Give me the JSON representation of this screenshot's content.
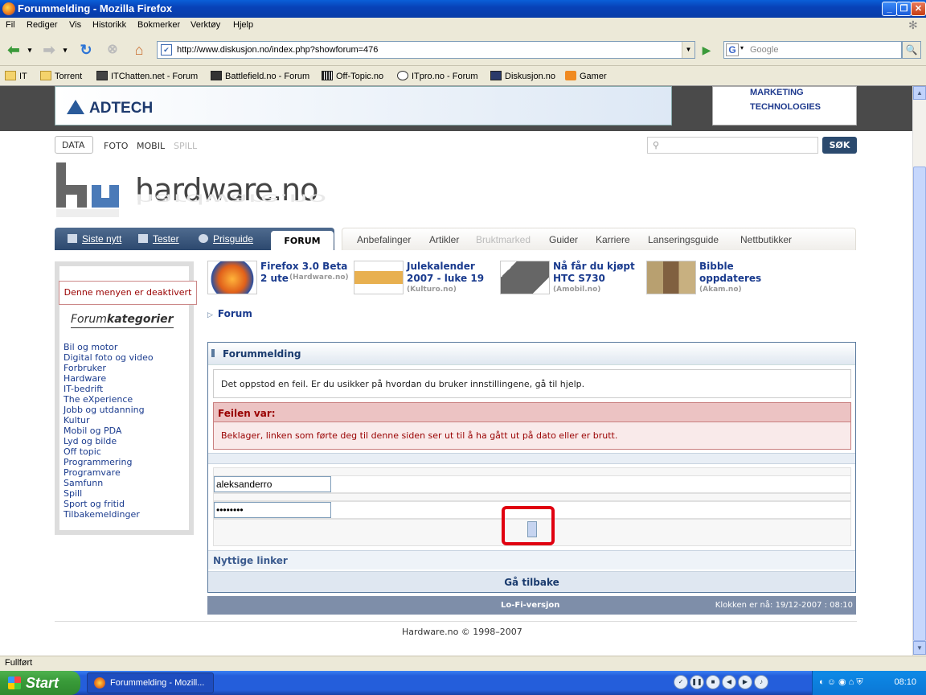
{
  "window": {
    "title": "Forummelding - Mozilla Firefox"
  },
  "menu": [
    "Fil",
    "Rediger",
    "Vis",
    "Historikk",
    "Bokmerker",
    "Verktøy",
    "Hjelp"
  ],
  "nav": {
    "url": "http://www.diskusjon.no/index.php?showforum=476",
    "search_placeholder": "Google"
  },
  "bookmarks": [
    "IT",
    "Torrent",
    "ITChatten.net - Forum",
    "Battlefield.no - Forum",
    "Off-Topic.no",
    "ITpro.no - Forum",
    "Diskusjon.no",
    "Gamer"
  ],
  "ads": {
    "left_logo": "ADTECH",
    "right_line1": "MARKETING",
    "right_line2": "TECHNOLOGIES"
  },
  "site": {
    "toplinks": [
      "DATA",
      "FOTO",
      "MOBIL",
      "SPILL"
    ],
    "search_button": "SØK",
    "brand": "hardware.no",
    "dark_tabs": [
      "Siste nytt",
      "Tester",
      "Prisguide",
      "FORUM"
    ],
    "light_tabs": [
      "Anbefalinger",
      "Artikler",
      "Bruktmarked",
      "Guider",
      "Karriere",
      "Lanseringsguide",
      "Nettbutikker"
    ]
  },
  "sidebar": {
    "menu_disabled": "Denne menyen er deaktivert",
    "heading_light": "Forum",
    "heading_bold": "kategorier",
    "categories": [
      "Bil og motor",
      "Digital foto og video",
      "Forbruker",
      "Hardware",
      "IT-bedrift",
      "The eXperience",
      "Jobb og utdanning",
      "Kultur",
      "Mobil og PDA",
      "Lyd og bilde",
      "Off topic",
      "Programmering",
      "Programvare",
      "Samfunn",
      "Spill",
      "Sport og fritid",
      "Tilbakemeldinger"
    ]
  },
  "news": [
    {
      "title": "Firefox 3.0 Beta 2 ute",
      "source": "(Hardware.no)"
    },
    {
      "title": "Julekalender 2007 - luke 19",
      "source": "(Kulturo.no)"
    },
    {
      "title": "Nå får du kjøpt HTC S730",
      "source": "(Amobil.no)"
    },
    {
      "title": "Bibble oppdateres",
      "source": "(Akam.no)"
    }
  ],
  "breadcrumb": "Forum",
  "forum_box": {
    "heading": "Forummelding",
    "info": "Det oppstod en feil. Er du usikker på hvordan du bruker innstillingene, gå til hjelp.",
    "error_heading": "Feilen var:",
    "error_message": "Beklager, linken som førte deg til denne siden ser ut til å ha gått ut på dato eller er brutt.",
    "username": "aleksanderro",
    "password": "********",
    "useful_links": "Nyttige linker",
    "go_back": "Gå tilbake"
  },
  "footer": {
    "lofi": "Lo-Fi-versjon",
    "clock": "Klokken er nå: 19/12-2007 : 08:10",
    "copyright": "Hardware.no © 1998–2007"
  },
  "status": "Fullført",
  "taskbar": {
    "start": "Start",
    "item": "Forummelding - Mozill...",
    "clock": "08:10"
  }
}
